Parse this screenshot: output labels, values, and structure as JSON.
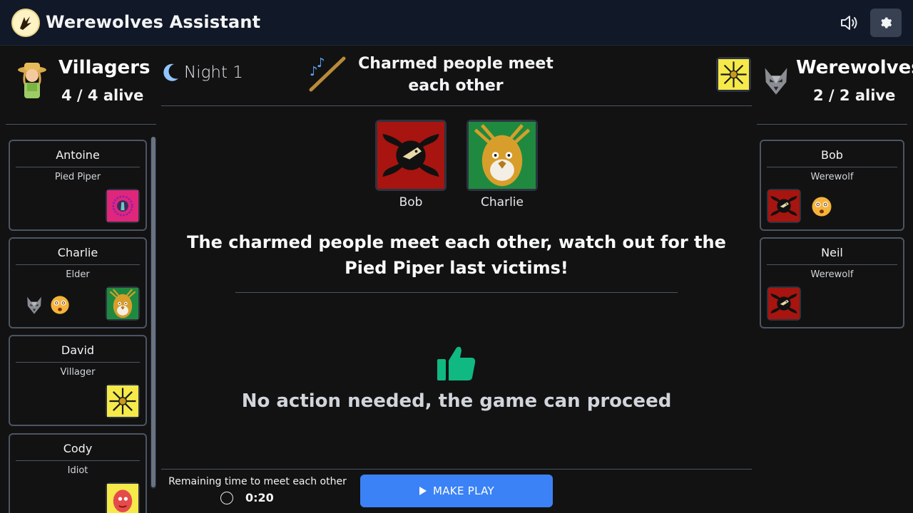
{
  "app": {
    "title": "Werewolves Assistant"
  },
  "header": {
    "sound_icon": "speaker-icon",
    "settings_icon": "gear-icon"
  },
  "villagers": {
    "name": "Villagers",
    "alive": "4 / 4 alive",
    "players": [
      {
        "name": "Antoine",
        "role": "Pied Piper"
      },
      {
        "name": "Charlie",
        "role": "Elder"
      },
      {
        "name": "David",
        "role": "Villager"
      },
      {
        "name": "Cody",
        "role": "Idiot"
      }
    ]
  },
  "werewolves": {
    "name": "Werewolves",
    "alive": "2 / 2 alive",
    "players": [
      {
        "name": "Bob",
        "role": "Werewolf"
      },
      {
        "name": "Neil",
        "role": "Werewolf"
      }
    ]
  },
  "phase": {
    "night": "Night 1",
    "title": "Charmed people meet each other",
    "selected": [
      "Bob",
      "Charlie"
    ],
    "message": "The charmed people meet each other, watch out for the Pied Piper last victims!",
    "no_action": "No action needed, the game can proceed"
  },
  "footer": {
    "timer_label": "Remaining time to meet each other",
    "timer_value": "0:20",
    "play_button": "MAKE PLAY"
  },
  "colors": {
    "accent": "#3b82f6",
    "success": "#10b981",
    "background": "#121212",
    "header": "#111827"
  }
}
